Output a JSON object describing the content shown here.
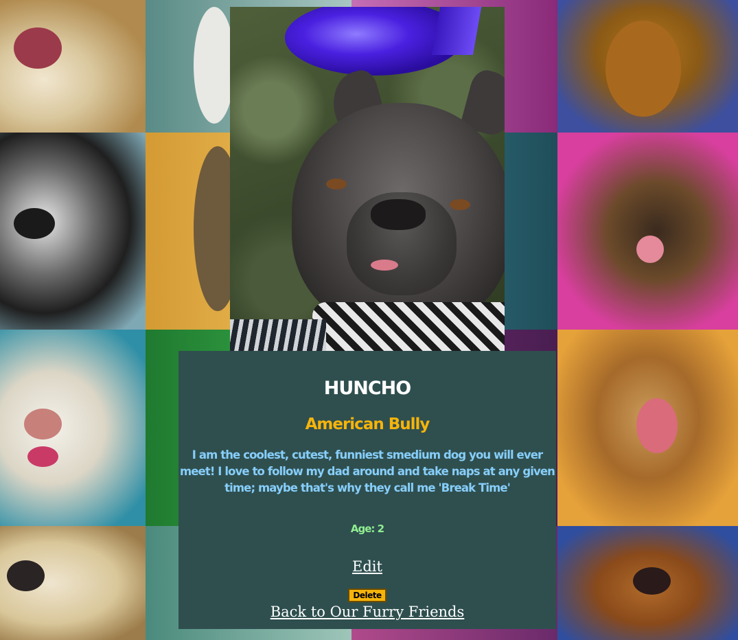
{
  "pet": {
    "name": "Huncho",
    "breed": "American Bully",
    "bio": "I am the coolest, cutest, funniest smedium dog you will ever meet! I love to follow my dad around and take naps at any given time; maybe that's why they call me 'Break Time'",
    "age_label": "Age:",
    "age_value": "2"
  },
  "actions": {
    "edit_label": "Edit",
    "delete_label": "Delete",
    "back_label": "Back to Our Furry Friends"
  },
  "colors": {
    "card_background": "#2f4f4f",
    "name": "#ffffff",
    "breed": "#f6b40b",
    "bio": "#87cefa",
    "age": "#90ee90",
    "delete_button": "#f6b40b"
  }
}
